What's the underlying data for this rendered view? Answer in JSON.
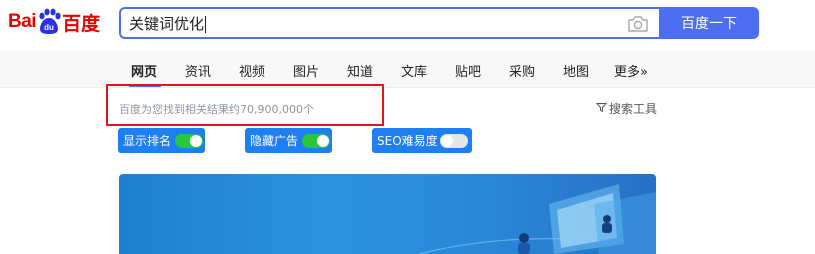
{
  "logo": {
    "text_left": "Bai",
    "text_right": "百度",
    "paw_text": "du"
  },
  "search": {
    "query": "关键词优化",
    "button_label": "百度一下"
  },
  "tabs": [
    {
      "label": "网页",
      "active": true
    },
    {
      "label": "资讯",
      "active": false
    },
    {
      "label": "视频",
      "active": false
    },
    {
      "label": "图片",
      "active": false
    },
    {
      "label": "知道",
      "active": false
    },
    {
      "label": "文库",
      "active": false
    },
    {
      "label": "贴吧",
      "active": false
    },
    {
      "label": "采购",
      "active": false
    },
    {
      "label": "地图",
      "active": false
    },
    {
      "label": "更多»",
      "active": false
    }
  ],
  "results": {
    "count_text": "百度为您找到相关结果约70,900,000个"
  },
  "search_tools": {
    "label": "搜索工具"
  },
  "toggles": [
    {
      "label": "显示排名",
      "on": true
    },
    {
      "label": "隐藏广告",
      "on": true
    },
    {
      "label": "SEO难易度",
      "on": false
    }
  ],
  "colors": {
    "brand_red": "#e10602",
    "brand_blue": "#4e6ef2",
    "toggle_blue": "#1d7ff1",
    "switch_on": "#29c73a",
    "highlight_box": "#e4121a"
  }
}
